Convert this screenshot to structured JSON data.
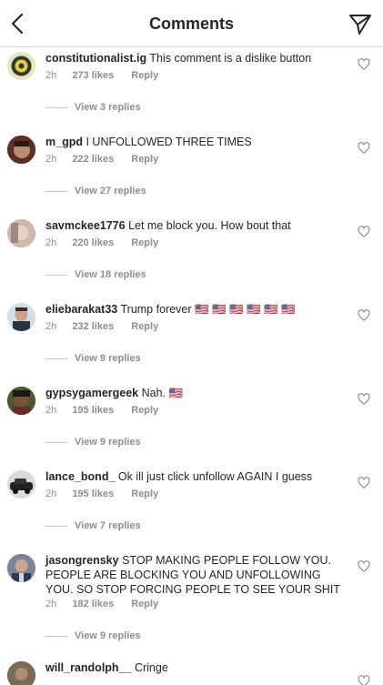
{
  "header": {
    "title": "Comments"
  },
  "comments": [
    {
      "username": "constitutionalist.ig",
      "text": "This comment is a dislike button",
      "time": "2h",
      "likes": "273 likes",
      "reply": "Reply",
      "view_replies": "View 3 replies"
    },
    {
      "username": "m_gpd",
      "text": "I UNFOLLOWED THREE TIMES",
      "time": "2h",
      "likes": "222 likes",
      "reply": "Reply",
      "view_replies": "View 27 replies"
    },
    {
      "username": "savmckee1776",
      "text": "Let me block you. How bout that",
      "time": "2h",
      "likes": "220 likes",
      "reply": "Reply",
      "view_replies": "View 18 replies"
    },
    {
      "username": "eliebarakat33",
      "text": "Trump forever 🇺🇸 🇺🇸 🇺🇸 🇺🇸 🇺🇸 🇺🇸",
      "time": "2h",
      "likes": "232 likes",
      "reply": "Reply",
      "view_replies": "View 9 replies"
    },
    {
      "username": "gypsygamergeek",
      "text": "Nah. 🇺🇸",
      "time": "2h",
      "likes": "195 likes",
      "reply": "Reply",
      "view_replies": "View 9 replies"
    },
    {
      "username": "lance_bond_",
      "text": "Ok ill just click unfollow AGAIN I guess",
      "time": "2h",
      "likes": "195 likes",
      "reply": "Reply",
      "view_replies": "View 7 replies"
    },
    {
      "username": "jasongrensky",
      "text": "STOP MAKING PEOPLE FOLLOW YOU. PEOPLE ARE BLOCKING YOU AND UNFOLLOWING YOU. SO STOP FORCING PEOPLE TO SEE YOUR SHIT",
      "time": "2h",
      "likes": "182 likes",
      "reply": "Reply",
      "view_replies": "View 9 replies"
    },
    {
      "username": "will_randolph__",
      "text": "Cringe"
    }
  ]
}
